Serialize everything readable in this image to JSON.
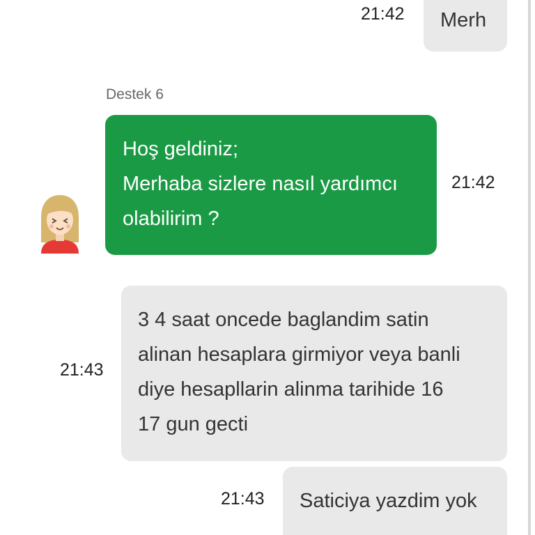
{
  "messages": [
    {
      "id": "m1",
      "direction": "outgoing",
      "text_lines": [
        "Merh"
      ],
      "time": "21:42"
    },
    {
      "id": "m2",
      "direction": "incoming",
      "sender": "Destek 6",
      "text_lines": [
        "Hoş geldiniz;",
        "Merhaba sizlere nasıl yardımcı",
        "olabilirim ?"
      ],
      "time": "21:42",
      "avatar": "agent-avatar-icon"
    },
    {
      "id": "m3",
      "direction": "outgoing",
      "text_lines": [
        "3 4 saat oncede baglandim satin",
        "alinan hesaplara girmiyor veya banli",
        "diye hesapllarin alinma tarihide 16",
        "17 gun gecti"
      ],
      "time": "21:43"
    },
    {
      "id": "m4",
      "direction": "outgoing",
      "text_lines": [
        "Saticiya yazdim yok"
      ],
      "time": "21:43"
    }
  ],
  "colors": {
    "agent_bubble": "#1a9a45",
    "user_bubble": "#e9e9e9",
    "avatar_hair": "#d7b56d",
    "avatar_shirt": "#e53935"
  }
}
